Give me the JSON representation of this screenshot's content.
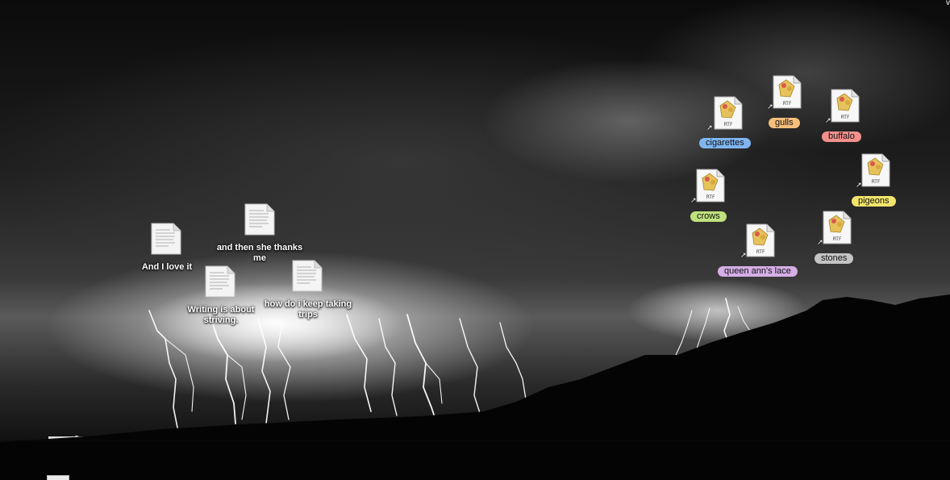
{
  "desktop": {
    "corner_mark": "v",
    "text_files": [
      {
        "name": "and then she thanks me"
      },
      {
        "name": "And I love it"
      },
      {
        "name": "Writing is about striving."
      },
      {
        "name": "how do i keep taking trips"
      }
    ],
    "rtf_aliases": [
      {
        "name": "cigarettes",
        "badge": "RTF",
        "label_color": "#7fb6f2"
      },
      {
        "name": "gulls",
        "badge": "RTF",
        "label_color": "#f5be7a"
      },
      {
        "name": "buffalo",
        "badge": "RTF",
        "label_color": "#f2908c"
      },
      {
        "name": "pigeons",
        "badge": "RTF",
        "label_color": "#f2e46a"
      },
      {
        "name": "crows",
        "badge": "RTF",
        "label_color": "#bfe07c"
      },
      {
        "name": "stones",
        "badge": "RTF",
        "label_color": "#c4c4c4"
      },
      {
        "name": "queen ann's lace",
        "badge": "RTF",
        "label_color": "#d6aee8"
      }
    ],
    "alias_arrow": "↗"
  }
}
